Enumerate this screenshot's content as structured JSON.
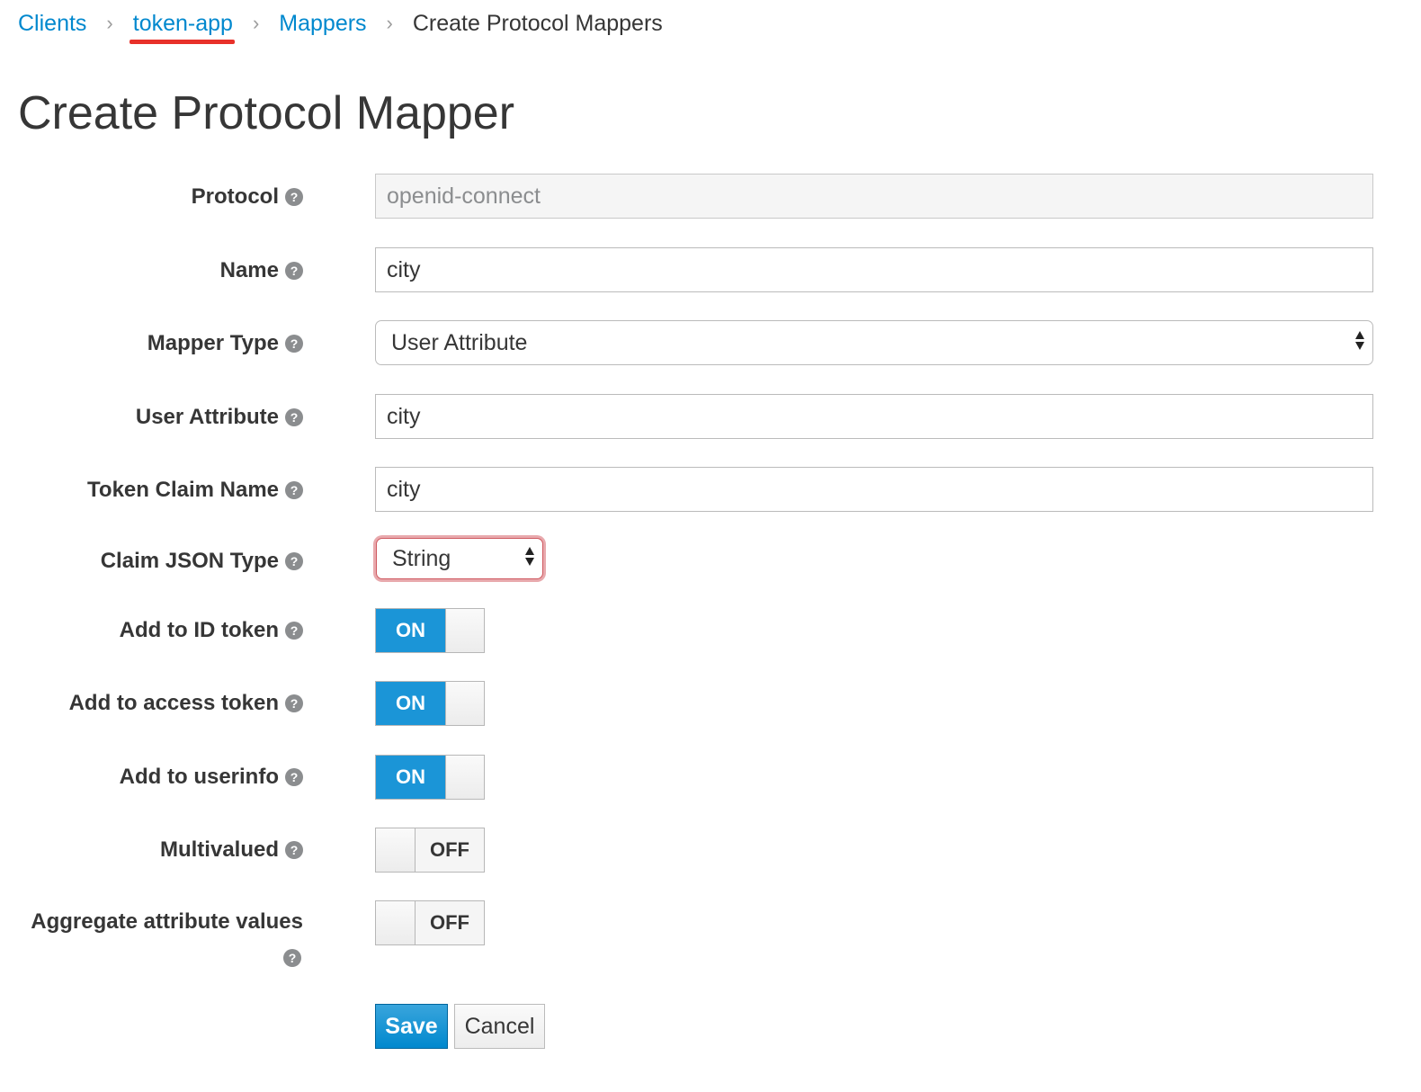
{
  "breadcrumb": {
    "items": [
      {
        "label": "Clients"
      },
      {
        "label": "token-app"
      },
      {
        "label": "Mappers"
      },
      {
        "label": "Create Protocol Mappers"
      }
    ],
    "separator": "›"
  },
  "page_title": "Create Protocol Mapper",
  "help_glyph": "?",
  "form": {
    "protocol": {
      "label": "Protocol",
      "value": "openid-connect"
    },
    "name": {
      "label": "Name",
      "value": "city"
    },
    "mapper_type": {
      "label": "Mapper Type",
      "selected": "User Attribute"
    },
    "user_attribute": {
      "label": "User Attribute",
      "value": "city"
    },
    "token_claim_name": {
      "label": "Token Claim Name",
      "value": "city"
    },
    "claim_json_type": {
      "label": "Claim JSON Type",
      "selected": "String"
    },
    "add_to_id_token": {
      "label": "Add to ID token",
      "state": "ON"
    },
    "add_to_access_token": {
      "label": "Add to access token",
      "state": "ON"
    },
    "add_to_userinfo": {
      "label": "Add to userinfo",
      "state": "ON"
    },
    "multivalued": {
      "label": "Multivalued",
      "state": "OFF"
    },
    "aggregate_attribute_values": {
      "label": "Aggregate attribute values",
      "state": "OFF"
    }
  },
  "buttons": {
    "save": "Save",
    "cancel": "Cancel"
  },
  "colors": {
    "link": "#0088ce",
    "switch_on": "#1b95d7",
    "annotation_red": "#e8312a",
    "highlight_border": "#cf5960"
  }
}
